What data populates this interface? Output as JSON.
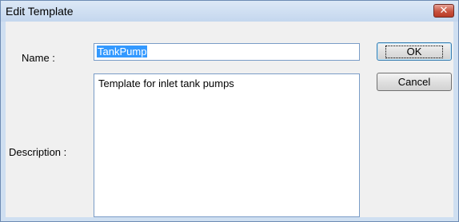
{
  "window": {
    "title": "Edit Template",
    "close_glyph": "✕"
  },
  "form": {
    "name_label": "Name :",
    "name_value": "TankPump",
    "description_label": "Description :",
    "description_value": "Template for inlet tank pumps"
  },
  "buttons": {
    "ok_label": "OK",
    "cancel_label": "Cancel"
  },
  "colors": {
    "selection": "#3399ff",
    "close_button": "#c8533f"
  },
  "icons": {
    "close": "close-icon"
  }
}
